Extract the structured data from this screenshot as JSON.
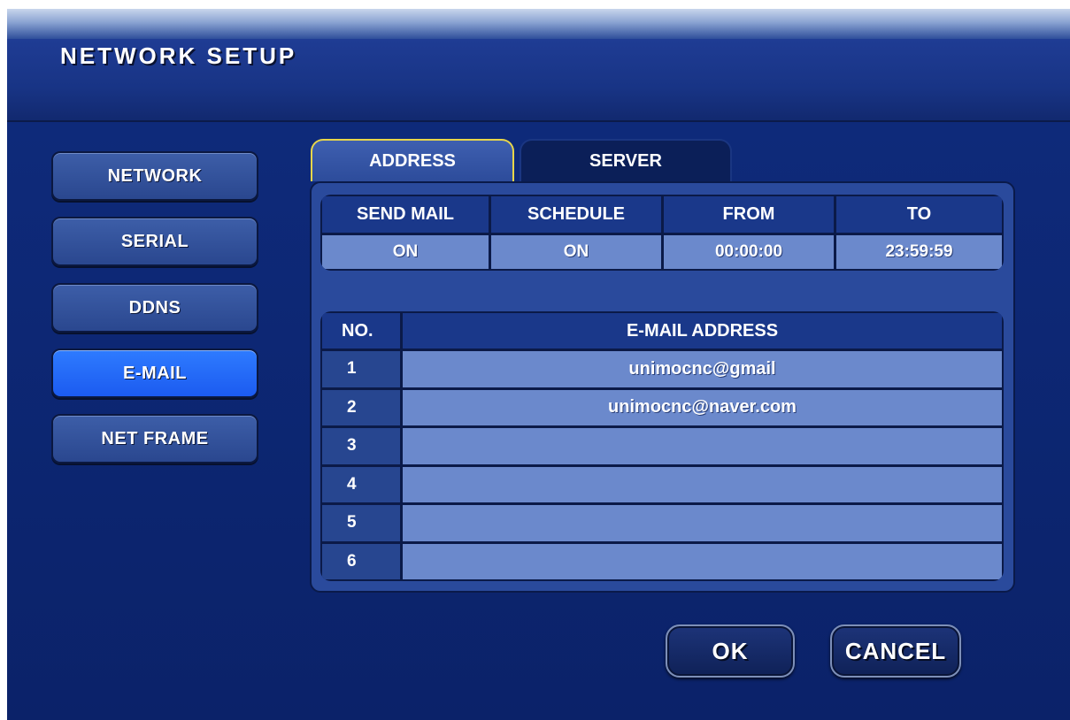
{
  "title": "NETWORK SETUP",
  "sidebar": {
    "items": [
      {
        "label": "NETWORK",
        "active": false
      },
      {
        "label": "SERIAL",
        "active": false
      },
      {
        "label": "DDNS",
        "active": false
      },
      {
        "label": "E-MAIL",
        "active": true
      },
      {
        "label": "NET FRAME",
        "active": false
      }
    ]
  },
  "tabs": [
    {
      "label": "ADDRESS",
      "active": true
    },
    {
      "label": "SERVER",
      "active": false
    }
  ],
  "mail_settings": {
    "headers": [
      "SEND MAIL",
      "SCHEDULE",
      "FROM",
      "TO"
    ],
    "values": [
      "ON",
      "ON",
      "00:00:00",
      "23:59:59"
    ]
  },
  "email_list": {
    "headers": {
      "no": "NO.",
      "address": "E-MAIL ADDRESS"
    },
    "rows": [
      {
        "no": "1",
        "address": "unimocnc@gmail"
      },
      {
        "no": "2",
        "address": "unimocnc@naver.com"
      },
      {
        "no": "3",
        "address": ""
      },
      {
        "no": "4",
        "address": ""
      },
      {
        "no": "5",
        "address": ""
      },
      {
        "no": "6",
        "address": ""
      }
    ]
  },
  "buttons": {
    "ok": "OK",
    "cancel": "CANCEL"
  },
  "colors": {
    "background": "#0a1e5c",
    "active_item": "#2e7bff",
    "tab_highlight": "#e8d64a",
    "cell_value": "#6b89cc"
  }
}
